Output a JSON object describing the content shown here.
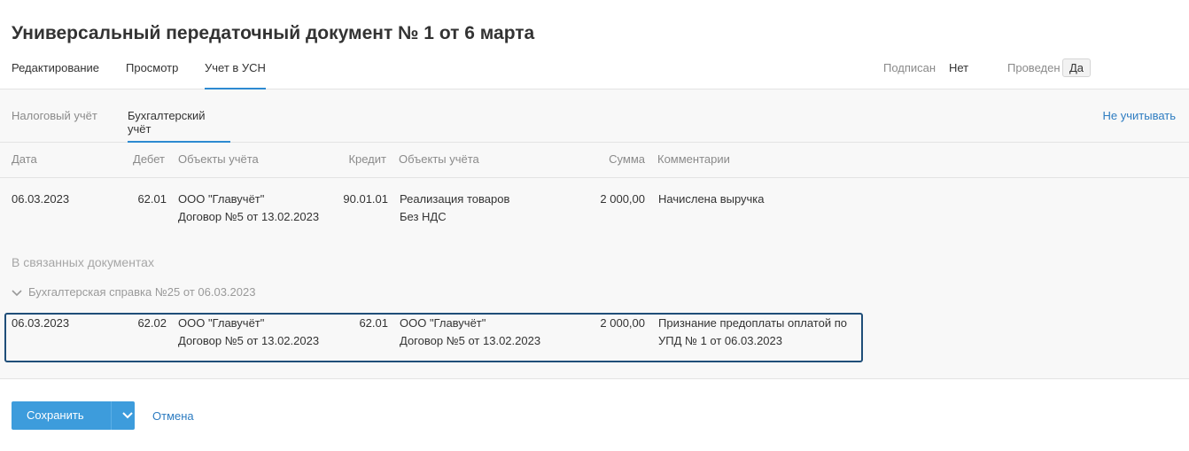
{
  "title": "Универсальный передаточный документ № 1 от 6 марта",
  "tabs": [
    "Редактирование",
    "Просмотр",
    "Учет в УСН"
  ],
  "status": {
    "signed_label": "Подписан",
    "signed_value": "Нет",
    "posted_label": "Проведен",
    "posted_value": "Да"
  },
  "subtabs": [
    "Налоговый учёт",
    "Бухгалтерский учёт"
  ],
  "exclude_link": "Не учитывать",
  "columns": [
    "Дата",
    "Дебет",
    "Объекты учёта",
    "Кредит",
    "Объекты учёта",
    "Сумма",
    "Комментарии"
  ],
  "rows": [
    {
      "date": "06.03.2023",
      "debit": "62.01",
      "debit_obj1": "ООО \"Главучёт\"",
      "debit_obj2": "Договор №5 от 13.02.2023",
      "credit": "90.01.01",
      "credit_obj1": "Реализация товаров",
      "credit_obj2": "Без НДС",
      "amount": "2 000,00",
      "comment1": "Начислена выручка",
      "comment2": ""
    }
  ],
  "related": {
    "section_label": "В связанных документах",
    "doc_title": "Бухгалтерская справка №25 от 06.03.2023",
    "row": {
      "date": "06.03.2023",
      "debit": "62.02",
      "debit_obj1": "ООО \"Главучёт\"",
      "debit_obj2": "Договор №5 от 13.02.2023",
      "credit": "62.01",
      "credit_obj1": "ООО \"Главучёт\"",
      "credit_obj2": "Договор №5 от 13.02.2023",
      "amount": "2 000,00",
      "comment1": "Признание предоплаты оплатой по",
      "comment2": "УПД № 1 от 06.03.2023"
    }
  },
  "footer": {
    "save_label": "Сохранить",
    "cancel_label": "Отмена"
  },
  "colors": {
    "accent": "#2d8ad1",
    "save_button": "#3d9cdc",
    "highlight_border": "#1f4e79",
    "link": "#2d7cc1"
  },
  "icons": [
    "chevron-down-icon"
  ]
}
